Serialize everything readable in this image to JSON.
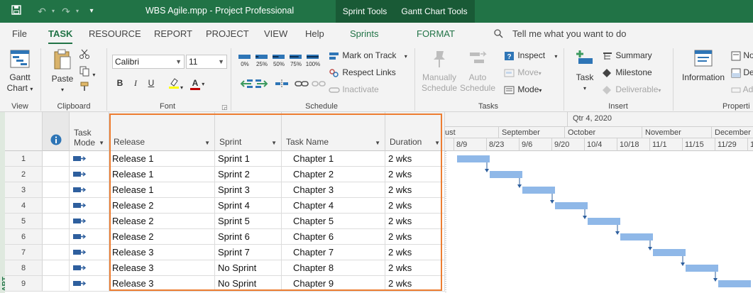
{
  "titlebar": {
    "title": "WBS Agile.mpp  -  Project Professional",
    "context_sprint": "Sprint Tools",
    "context_gantt": "Gantt Chart Tools"
  },
  "tabs": {
    "file": "File",
    "task": "TASK",
    "resource": "RESOURCE",
    "report": "REPORT",
    "project": "PROJECT",
    "view": "VIEW",
    "help": "Help",
    "sprints": "Sprints",
    "format": "FORMAT",
    "tellme": "Tell me what you want to do"
  },
  "ribbon": {
    "view": {
      "gantt_line1": "Gantt",
      "gantt_line2": "Chart",
      "label": "View"
    },
    "clipboard": {
      "paste": "Paste",
      "label": "Clipboard"
    },
    "font": {
      "family": "Calibri",
      "size": "11",
      "bold": "B",
      "italic": "I",
      "underline": "U",
      "color_a": "A",
      "label": "Font"
    },
    "schedule": {
      "pct": [
        "0%",
        "25%",
        "50%",
        "75%",
        "100%"
      ],
      "mark_on_track": "Mark on Track",
      "respect_links": "Respect Links",
      "inactivate": "Inactivate",
      "label": "Schedule"
    },
    "tasks": {
      "manually_1": "Manually",
      "manually_2": "Schedule",
      "auto_1": "Auto",
      "auto_2": "Schedule",
      "inspect": "Inspect",
      "move": "Move",
      "mode": "Mode",
      "label": "Tasks"
    },
    "insert": {
      "task": "Task",
      "summary": "Summary",
      "milestone": "Milestone",
      "deliverable": "Deliverable",
      "label": "Insert"
    },
    "properties": {
      "information": "Information",
      "no": "No",
      "de": "De",
      "ad": "Ad",
      "label": "Properti"
    }
  },
  "grid": {
    "columns": {
      "task_mode_1": "Task",
      "task_mode_2": "Mode",
      "release": "Release",
      "sprint": "Sprint",
      "task_name": "Task Name",
      "duration": "Duration"
    },
    "rows": [
      {
        "id": "1",
        "release": "Release 1",
        "sprint": "Sprint 1",
        "task_name": "Chapter 1",
        "duration": "2 wks"
      },
      {
        "id": "2",
        "release": "Release 1",
        "sprint": "Sprint 2",
        "task_name": "Chapter 2",
        "duration": "2 wks"
      },
      {
        "id": "3",
        "release": "Release 1",
        "sprint": "Sprint 3",
        "task_name": "Chapter 3",
        "duration": "2 wks"
      },
      {
        "id": "4",
        "release": "Release 2",
        "sprint": "Sprint 4",
        "task_name": "Chapter 4",
        "duration": "2 wks"
      },
      {
        "id": "5",
        "release": "Release 2",
        "sprint": "Sprint 5",
        "task_name": "Chapter 5",
        "duration": "2 wks"
      },
      {
        "id": "6",
        "release": "Release 2",
        "sprint": "Sprint 6",
        "task_name": "Chapter 6",
        "duration": "2 wks"
      },
      {
        "id": "7",
        "release": "Release 3",
        "sprint": "Sprint 7",
        "task_name": "Chapter 7",
        "duration": "2 wks"
      },
      {
        "id": "8",
        "release": "Release 3",
        "sprint": "No Sprint",
        "task_name": "Chapter 8",
        "duration": "2 wks"
      },
      {
        "id": "9",
        "release": "Release 3",
        "sprint": "No Sprint",
        "task_name": "Chapter 9",
        "duration": "2 wks"
      }
    ],
    "sideband": "ART"
  },
  "gantt": {
    "quarter": "Qtr 4, 2020",
    "months": [
      "ust",
      "September",
      "October",
      "November",
      "December"
    ],
    "weeks": [
      "8/9",
      "8/23",
      "9/6",
      "9/20",
      "10/4",
      "10/18",
      "11/1",
      "11/15",
      "11/29",
      "1"
    ],
    "bar_color": "#8fb8e8",
    "bars": [
      {
        "start": "8/9",
        "weeks": 2
      },
      {
        "start": "8/23",
        "weeks": 2
      },
      {
        "start": "9/6",
        "weeks": 2
      },
      {
        "start": "9/20",
        "weeks": 2
      },
      {
        "start": "10/4",
        "weeks": 2
      },
      {
        "start": "10/18",
        "weeks": 2
      },
      {
        "start": "11/1",
        "weeks": 2
      },
      {
        "start": "11/15",
        "weeks": 2
      },
      {
        "start": "11/29",
        "weeks": 2
      }
    ]
  },
  "colors": {
    "accent": "#217346",
    "highlight": "#ed7d31"
  }
}
